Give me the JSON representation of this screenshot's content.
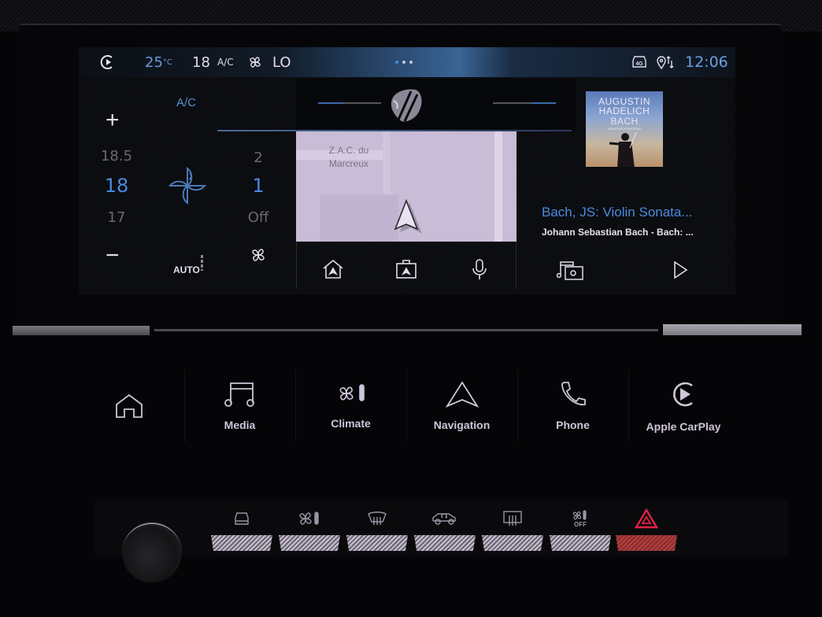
{
  "status_bar": {
    "carplay_icon": "carplay-icon",
    "outside_temp": "25",
    "outside_temp_unit": "°C",
    "set_temp": "18",
    "ac_label": "A/C",
    "fan_icon": "fan-icon",
    "fan_level": "LO",
    "page_indicator": {
      "pages": 3,
      "active": 1
    },
    "connectivity_icon": "4g-car-icon",
    "location_icon": "location-sharing-icon",
    "connectivity_label": "4G",
    "time": "12:06"
  },
  "climate": {
    "ac_label": "A/C",
    "temp_up_label": "+",
    "temp_down_label": "−",
    "temp_above": "18.5",
    "temp_current": "18",
    "temp_below": "17",
    "fan_above": "2",
    "fan_current": "1",
    "fan_below": "Off",
    "auto_label": "AUTO"
  },
  "navigation": {
    "map_label_line1": "Z.A.C. du",
    "map_label_line2": "Marcreux",
    "actions": [
      {
        "name": "home-destination",
        "icon": "home-nav-icon"
      },
      {
        "name": "work-destination",
        "icon": "work-nav-icon"
      },
      {
        "name": "voice-command",
        "icon": "microphone-icon"
      }
    ]
  },
  "media": {
    "album_art": {
      "line1": "AUGUSTIN",
      "line2": "HADELICH",
      "line3": "BACH",
      "line4": "SONATAS & PARTITAS"
    },
    "title": "Bach, JS: Violin Sonata...",
    "artist": "Johann Sebastian Bach - Bach: ...",
    "source_icon": "music-radio-source-icon",
    "play_icon": "play-icon"
  },
  "touch_bar": {
    "items": [
      {
        "label": "",
        "icon": "home-icon"
      },
      {
        "label": "Media",
        "icon": "music-note-icon"
      },
      {
        "label": "Climate",
        "icon": "fan-thermometer-icon"
      },
      {
        "label": "Navigation",
        "icon": "navigation-arrow-icon"
      },
      {
        "label": "Phone",
        "icon": "phone-icon"
      },
      {
        "label": "Apple CarPlay",
        "icon": "carplay-icon"
      }
    ]
  },
  "physical_buttons": [
    {
      "icon": "front-car-icon"
    },
    {
      "icon": "climate-icon"
    },
    {
      "icon": "front-defrost-icon"
    },
    {
      "icon": "recirculation-icon"
    },
    {
      "icon": "rear-defrost-icon"
    },
    {
      "icon": "climate-off-icon",
      "label": "OFF"
    },
    {
      "icon": "hazard-icon"
    }
  ],
  "colors": {
    "accent_blue": "#4a8ae0",
    "text_light": "#e0dcea",
    "hazard_red": "#e0204a"
  }
}
